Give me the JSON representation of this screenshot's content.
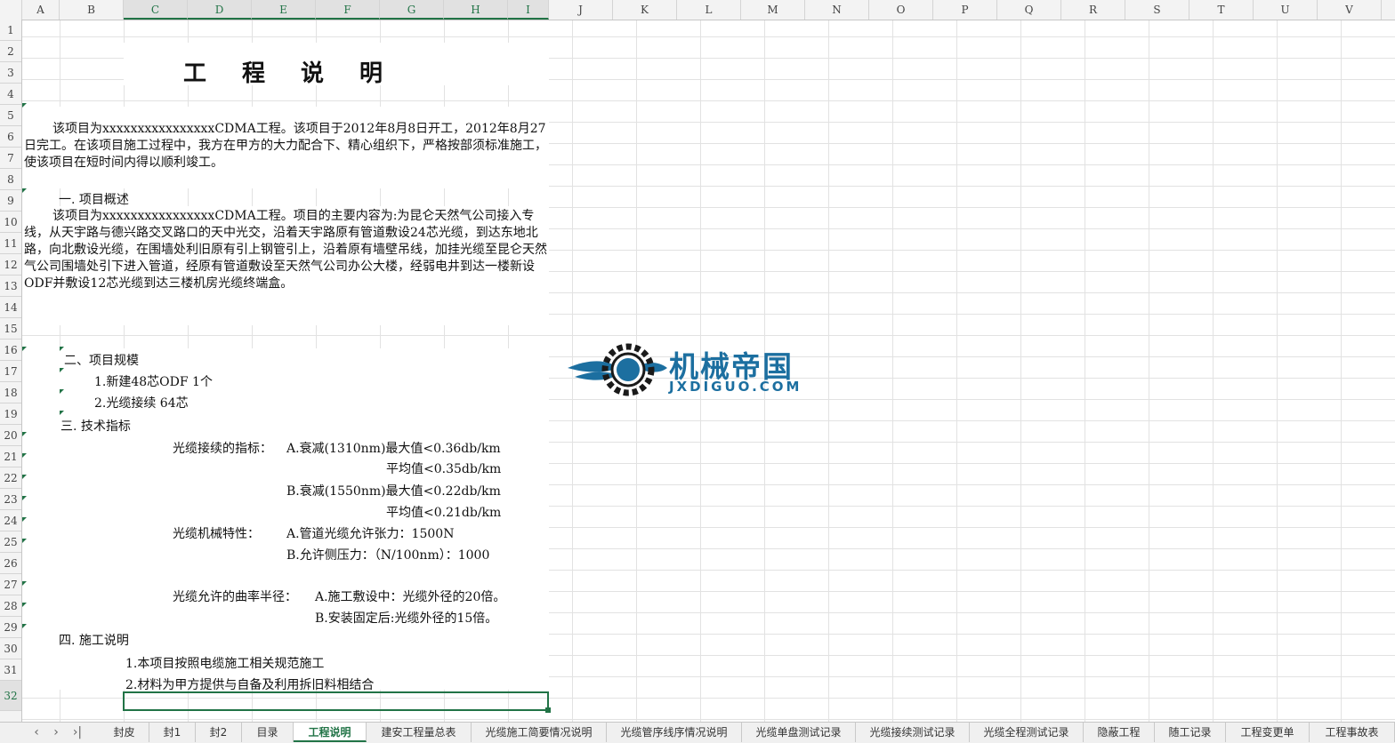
{
  "columns": [
    "A",
    "B",
    "C",
    "D",
    "E",
    "F",
    "G",
    "H",
    "I",
    "J",
    "K",
    "L",
    "M",
    "N",
    "O",
    "P",
    "Q",
    "R",
    "S",
    "T",
    "U",
    "V"
  ],
  "rows": [
    "1",
    "2",
    "3",
    "4",
    "5",
    "6",
    "7",
    "8",
    "9",
    "10",
    "11",
    "12",
    "13",
    "14",
    "15",
    "16",
    "17",
    "18",
    "19",
    "20",
    "21",
    "22",
    "23",
    "24",
    "25",
    "26",
    "27",
    "28",
    "29",
    "30",
    "31",
    "32"
  ],
  "doc": {
    "title_chars": [
      "工",
      "程",
      "说",
      "明"
    ],
    "intro": "该项目为xxxxxxxxxxxxxxxxCDMA工程。该项目于2012年8月8日开工，2012年8月27日完工。在该项目施工过程中，我方在甲方的大力配合下、精心组织下，严格按部须标准施工，使该项目在短时间内得以顺利竣工。",
    "sec1_title": "一.  项目概述",
    "sec1_body": "该项目为xxxxxxxxxxxxxxxxCDMA工程。项目的主要内容为:为昆仑天然气公司接入专线，从天宇路与德兴路交叉路口的天中光交，沿着天宇路原有管道敷设24芯光缆，到达东地北路，向北敷设光缆，在围墙处利旧原有引上钢管引上，沿着原有墙壁吊线，加挂光缆至昆仑天然气公司围墙处引下进入管道，经原有管道敷设至天然气公司办公大楼，经弱电井到达一楼新设ODF并敷设12芯光缆到达三楼机房光缆终端盒。",
    "sec2_title": "二、项目规模",
    "sec2_item1": "1.新建48芯ODF    1个",
    "sec2_item2": "2.光缆接续   64芯",
    "sec3_title": "三.  技术指标",
    "splice_label": "光缆接续的指标：",
    "splice_a": "A.衰减(1310nm)最大值<0.36db/km",
    "splice_a_avg": "平均值<0.35db/km",
    "splice_b": "B.衰减(1550nm)最大值<0.22db/km",
    "splice_b_avg": "平均值<0.21db/km",
    "mech_label": "光缆机械特性：",
    "mech_a": "A.管道光缆允许张力：1500N",
    "mech_b": "B.允许侧压力：（N/100nm）：1000",
    "bend_label": "光缆允许的曲率半径：",
    "bend_a": "A.施工敷设中：光缆外径的20倍。",
    "bend_b": "B.安装固定后:光缆外径的15倍。",
    "sec4_title": "四.  施工说明",
    "sec4_item1": "1.本项目按照电缆施工相关规范施工",
    "sec4_item2": "2.材料为甲方提供与自备及利用拆旧料相结合"
  },
  "watermark": {
    "text": "机械帝国",
    "sub": "JXDIGUO.COM",
    "color": "#1c6fa0"
  },
  "tabs": {
    "nav": [
      "‹",
      "›",
      "›|"
    ],
    "items": [
      "封皮",
      "封1",
      "封2",
      "目录",
      "工程说明",
      "建安工程量总表",
      "光缆施工简要情况说明",
      "光缆管序线序情况说明",
      "光缆单盘测试记录",
      "光缆接续测试记录",
      "光缆全程测试记录",
      "隐蔽工程",
      "随工记录",
      "工程变更单",
      "工程事故表"
    ],
    "active_index": 4
  },
  "accent_color": "#217346"
}
